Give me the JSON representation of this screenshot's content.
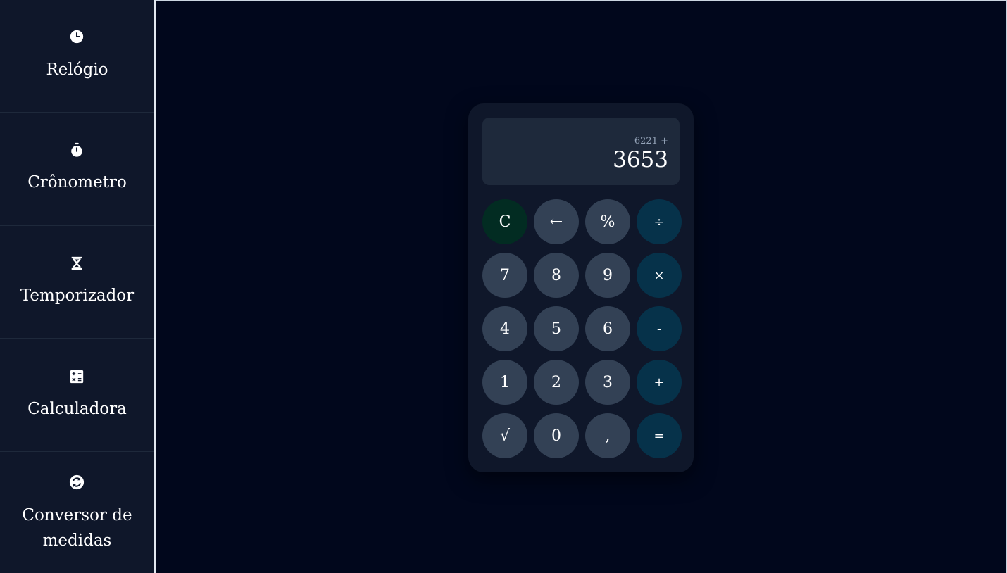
{
  "sidebar": {
    "items": [
      {
        "label": "Relógio",
        "icon": "clock-icon"
      },
      {
        "label": "Crônometro",
        "icon": "stopwatch-icon"
      },
      {
        "label": "Temporizador",
        "icon": "hourglass-icon"
      },
      {
        "label": "Calculadora",
        "icon": "calculator-icon"
      },
      {
        "label": "Conversor de",
        "label2": "medidas",
        "icon": "convert-icon"
      }
    ]
  },
  "calculator": {
    "expression": "6221 +",
    "value": "3653",
    "keys": {
      "clear": "C",
      "backspace": "←",
      "percent": "%",
      "divide": "÷",
      "seven": "7",
      "eight": "8",
      "nine": "9",
      "multiply": "×",
      "four": "4",
      "five": "5",
      "six": "6",
      "subtract": "-",
      "one": "1",
      "two": "2",
      "three": "3",
      "add": "+",
      "sqrt": "√",
      "zero": "0",
      "comma": ",",
      "equals": "="
    }
  },
  "colors": {
    "background": "#01071c",
    "sidebar": "#0f172a",
    "calculator_body": "#0f172a",
    "display": "#1e293b",
    "number_key": "#334155",
    "operator_key": "#06324a",
    "clear_key": "#022c22"
  }
}
